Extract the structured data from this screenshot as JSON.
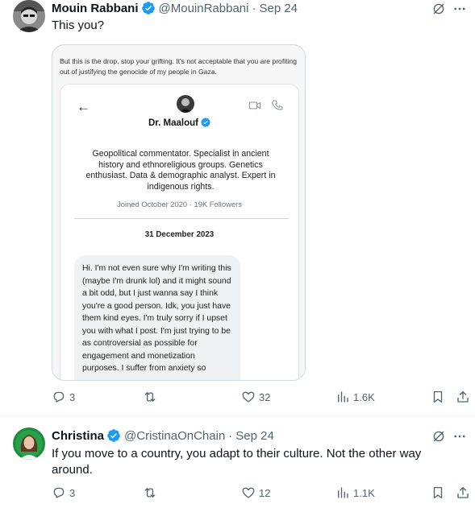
{
  "tweets": [
    {
      "author": "Mouin Rabbani",
      "handle": "@MouinRabbani",
      "separator": "·",
      "date": "Sep 24",
      "text": "This you?",
      "media": {
        "caption": "But this is the drop, stop your grifting. It's not acceptable that you are profiting out of justifying the genocide of my people in Gaza.",
        "back_arrow": "←",
        "profile_name": "Dr. Maalouf",
        "bio": "Geopolitical commentator. Specialist in ancient history and ethnoreligious groups. Genetics enthusiast. Data & demographic analyst. Expert in indigenous rights.",
        "joined": "Joined October 2020 · 19K Followers",
        "conversation_date": "31 December 2023",
        "message": "Hi. I'm not even sure why I'm writing this (maybe I'm drunk lol) and it might sound a bit odd, but I just wanna say I think you're a good person. Idk, you just have them kind eyes. I'm truly sorry if I upset you with what I post. I'm just trying to be as controversial as possible for engagement and monetization purposes. I suffer from anxiety so"
      },
      "stats": {
        "replies": "3",
        "reposts": "",
        "likes": "32",
        "views": "1.6K"
      }
    },
    {
      "author": "Christina",
      "handle": "@CristinaOnChain",
      "separator": "·",
      "date": "Sep 24",
      "text": "If you move to a country, you adapt to their culture. Not the other way around.",
      "stats": {
        "replies": "3",
        "reposts": "",
        "likes": "12",
        "views": "1.1K"
      }
    }
  ],
  "colors": {
    "verified": "#1d9bf0",
    "secondary_text": "#536471",
    "grok_icon": "#536471"
  },
  "icons": [
    "verified-badge-icon",
    "grok-icon",
    "more-icon",
    "reply-icon",
    "repost-icon",
    "like-icon",
    "views-icon",
    "bookmark-icon",
    "share-icon",
    "video-call-icon",
    "phone-icon"
  ]
}
